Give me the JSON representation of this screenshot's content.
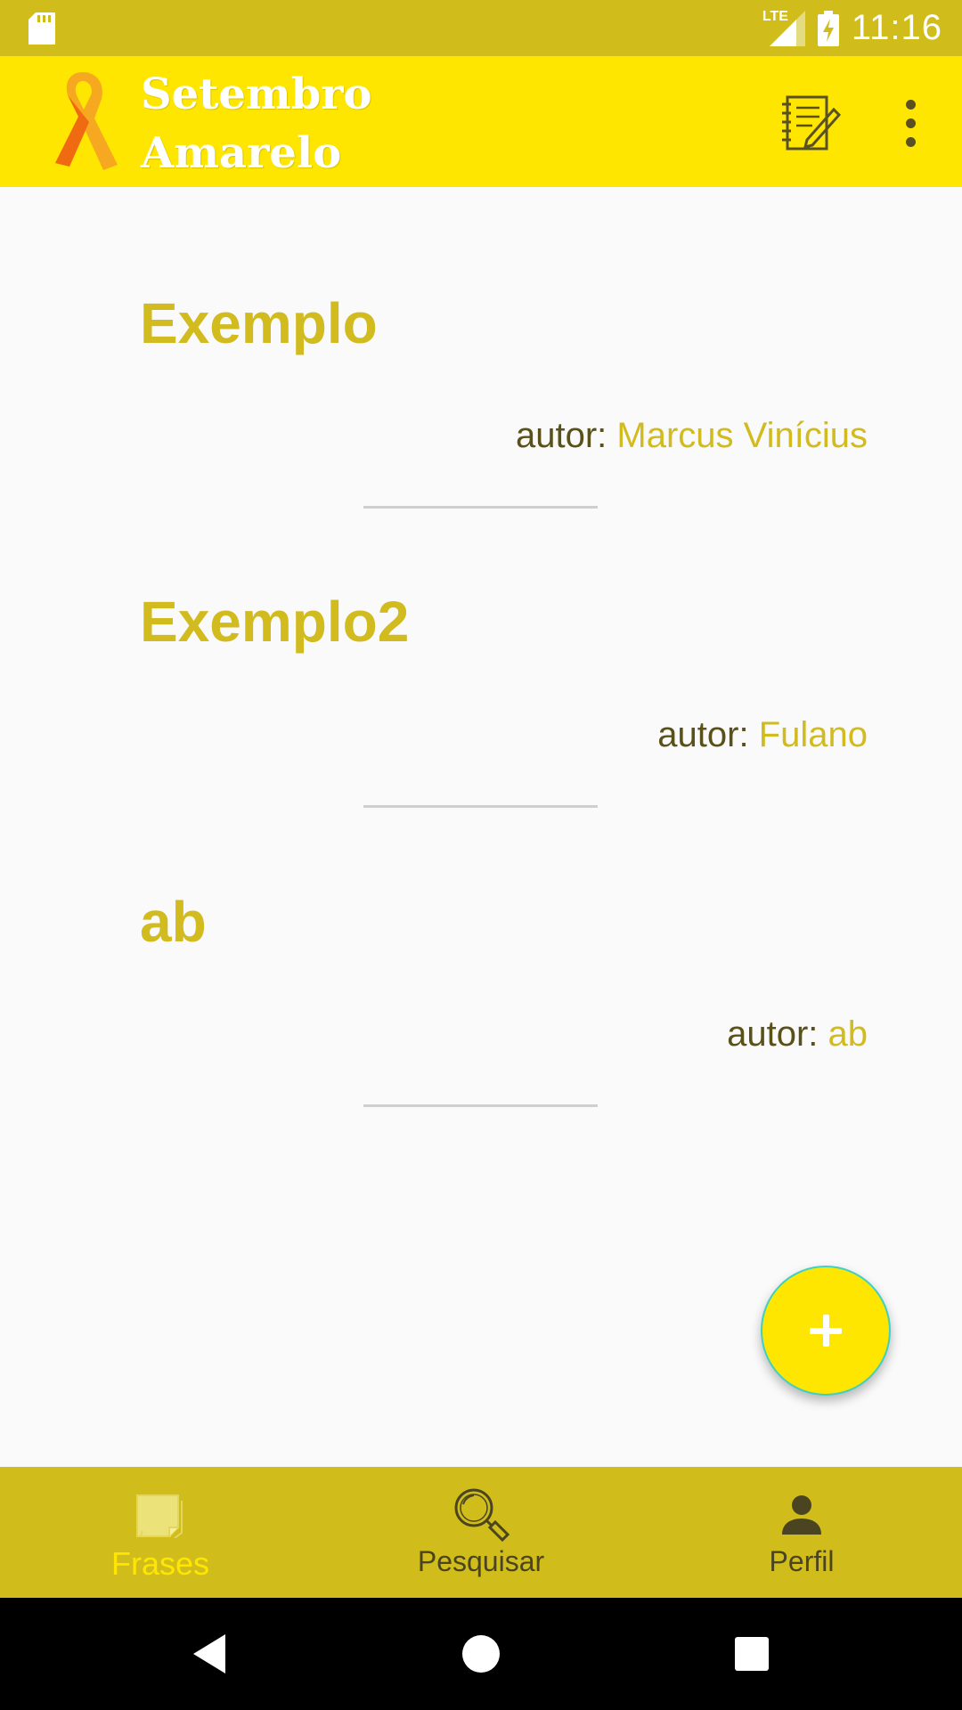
{
  "status_bar": {
    "network_label": "LTE",
    "time": "11:16"
  },
  "app_bar": {
    "title_line1": "Setembro",
    "title_line2": "Amarelo",
    "icons": [
      "ribbon-logo",
      "notes-icon",
      "overflow-menu-icon"
    ]
  },
  "phrases": [
    {
      "title": "Exemplo",
      "author_prefix": "autor: ",
      "author": "Marcus Vinícius"
    },
    {
      "title": "Exemplo2",
      "author_prefix": "autor: ",
      "author": "Fulano"
    },
    {
      "title": "ab",
      "author_prefix": "autor: ",
      "author": "ab"
    }
  ],
  "fab": {
    "icon": "plus-icon"
  },
  "bottom_nav": {
    "items": [
      {
        "label": "Frases",
        "icon": "notes-stack-icon",
        "active": true
      },
      {
        "label": "Pesquisar",
        "icon": "search-icon",
        "active": false
      },
      {
        "label": "Perfil",
        "icon": "person-icon",
        "active": false
      }
    ]
  },
  "colors": {
    "status_bar": "#d0bd1c",
    "app_bar": "#ffe600",
    "accent_text": "#d1bb1f",
    "bottom_nav": "#d0bd1c",
    "active_nav": "#ffe600"
  }
}
